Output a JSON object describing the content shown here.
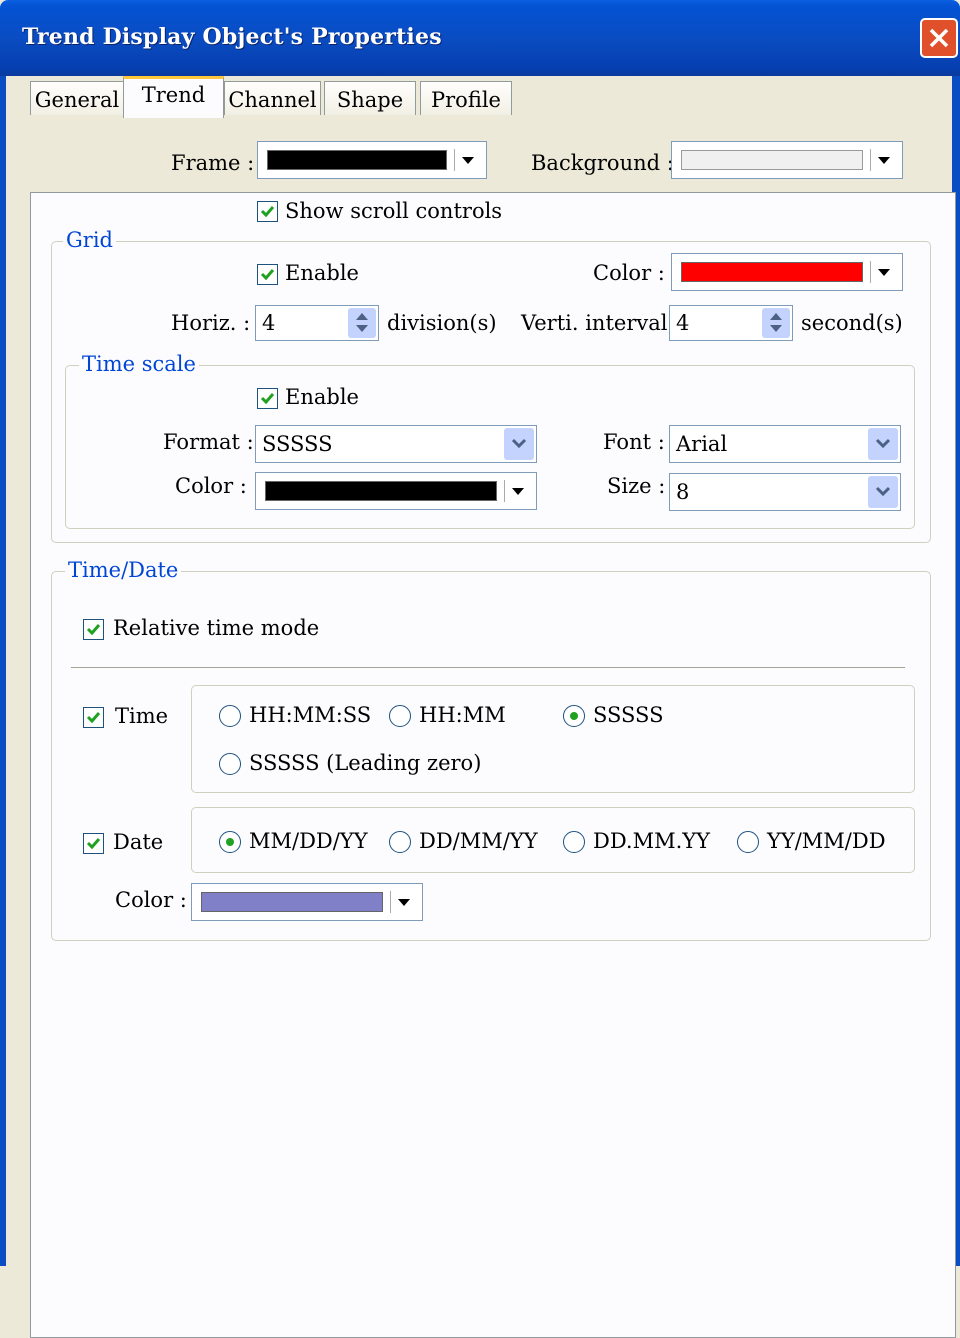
{
  "window": {
    "title": "Trend Display Object's Properties"
  },
  "tabs": [
    {
      "label": "General"
    },
    {
      "label": "Trend"
    },
    {
      "label": "Channel"
    },
    {
      "label": "Shape"
    },
    {
      "label": "Profile"
    }
  ],
  "frame": {
    "label": "Frame :",
    "color": "#000000"
  },
  "background": {
    "label": "Background :",
    "color": "#f0f0f0"
  },
  "show_scroll": {
    "label": "Show scroll controls",
    "checked": true
  },
  "grid": {
    "title": "Grid",
    "enable_label": "Enable",
    "color_label": "Color :",
    "color": "#ff0000",
    "horiz_label": "Horiz. :",
    "horiz_value": "4",
    "horiz_unit": "division(s)",
    "verti_label": "Verti. interval :",
    "verti_value": "4",
    "verti_unit": "second(s)"
  },
  "time_scale": {
    "title": "Time scale",
    "enable_label": "Enable",
    "format_label": "Format :",
    "format_value": "SSSSS",
    "font_label": "Font :",
    "font_value": "Arial",
    "color_label": "Color :",
    "color": "#000000",
    "size_label": "Size :",
    "size_value": "8"
  },
  "time_date": {
    "title": "Time/Date",
    "relative_label": "Relative time mode",
    "time_label": "Time",
    "time_options": [
      "HH:MM:SS",
      "HH:MM",
      "SSSSS",
      "SSSSS (Leading zero)"
    ],
    "time_selected": "SSSSS",
    "date_label": "Date",
    "date_options": [
      "MM/DD/YY",
      "DD/MM/YY",
      "DD.MM.YY",
      "YY/MM/DD"
    ],
    "date_selected": "MM/DD/YY",
    "color_label": "Color :",
    "color": "#8080c8"
  },
  "colors": {
    "accent": "#0046d5",
    "title_bar": "#0a4cc2",
    "check": "#21a121"
  }
}
